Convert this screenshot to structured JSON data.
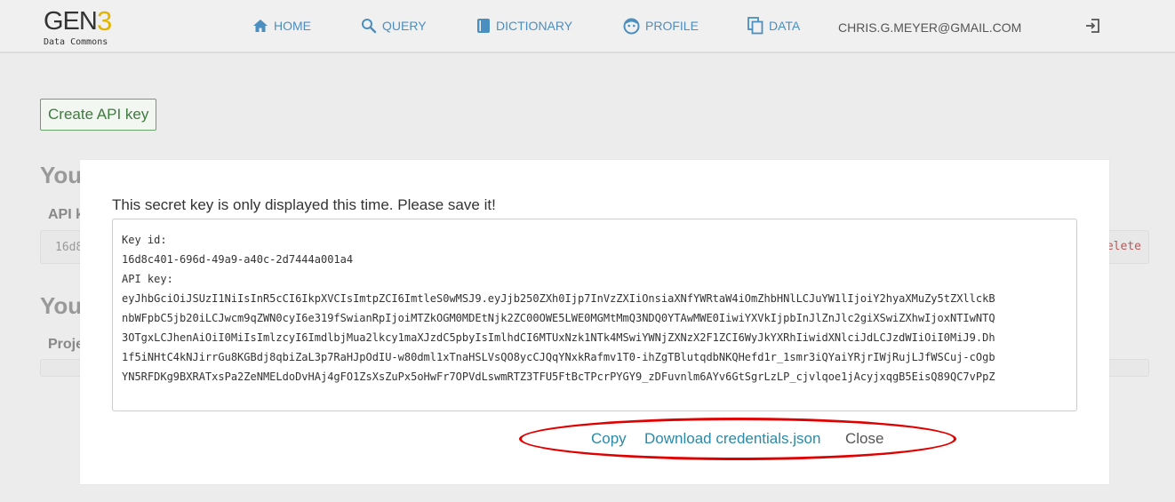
{
  "brand": {
    "name": "GEN",
    "number": "3",
    "subtitle": "Data Commons"
  },
  "nav": {
    "items": [
      {
        "label": "HOME",
        "icon": "home-icon"
      },
      {
        "label": "QUERY",
        "icon": "search-icon"
      },
      {
        "label": "DICTIONARY",
        "icon": "book-icon"
      },
      {
        "label": "PROFILE",
        "icon": "face-icon"
      },
      {
        "label": "DATA",
        "icon": "copy-icon"
      }
    ],
    "user_email": "CHRIS.G.MEYER@GMAIL.COM",
    "logout_icon": "logout-icon"
  },
  "page": {
    "create_button": "Create API key",
    "section1_heading": "You",
    "section1_sub": "API k",
    "key_row_text": "16d8",
    "key_row_delete": "elete",
    "section2_heading": "You",
    "section2_sub": "Proje"
  },
  "modal": {
    "message": "This secret key is only displayed this time. Please save it!",
    "key_id_label": "Key id:",
    "key_id": "16d8c401-696d-49a9-a40c-2d7444a001a4",
    "api_key_label": "API key:",
    "api_key_lines": [
      "eyJhbGciOiJSUzI1NiIsInR5cCI6IkpXVCIsImtpZCI6ImtleS0wMSJ9.eyJjb250ZXh0Ijp7InVzZXIiOnsiaXNfYWRtaW4iOmZhbHNlLCJuYW1lIjoiY2hyaXMuZy5tZXllckB",
      "nbWFpbC5jb20iLCJwcm9qZWN0cyI6e319fSwianRpIjoiMTZkOGM0MDEtNjk2ZC00OWE5LWE0MGMtMmQ3NDQ0YTAwMWE0IiwiYXVkIjpbInJlZnJlc2giXSwiZXhwIjoxNTIwNTQ",
      "3OTgxLCJhenAiOiI0MiIsImlzcyI6ImdlbjMua2lkcy1maXJzdC5pbyIsImlhdCI6MTUxNzk1NTk4MSwiYWNjZXNzX2F1ZCI6WyJkYXRhIiwidXNlciJdLCJzdWIiOiI0MiJ9.Dh",
      "1f5iNHtC4kNJirrGu8KGBdj8qbiZaL3p7RaHJpOdIU-w80dml1xTnaHSLVsQO8ycCJQqYNxkRafmv1T0-ihZgTBlutqdbNKQHefd1r_1smr3iQYaiYRjrIWjRujLJfWSCuj-cOgb",
      "YN5RFDKg9BXRATxsPa2ZeNMELdoDvHAj4gFO1ZsXsZuPx5oHwFr7OPVdLswmRTZ3TFU5FtBcTPcrPYGY9_zDFuvnlm6AYv6GtSgrLzLP_cjvlqoe1jAcyjxqgB5EisQ89QC7vPpZ"
    ],
    "actions": {
      "copy": "Copy",
      "download": "Download credentials.json",
      "close": "Close"
    }
  }
}
